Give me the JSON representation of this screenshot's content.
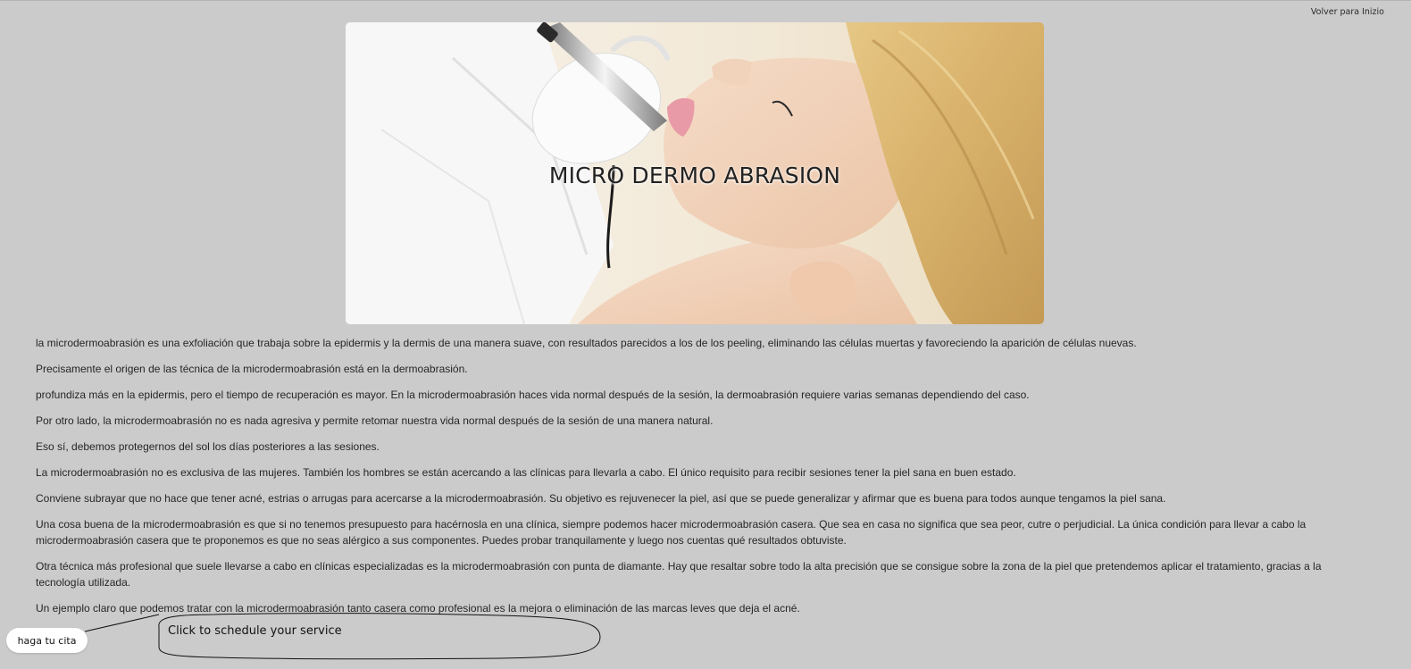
{
  "nav": {
    "back_label": "Volver para Inizio"
  },
  "hero": {
    "title": "MICRO DERMO ABRASION",
    "image": "woman-receiving-microdermabrasion-photo"
  },
  "article": {
    "paragraphs": [
      "la microdermoabrasión es una exfoliación que trabaja sobre la epidermis y la dermis de una manera suave, con resultados parecidos a los de los peeling, eliminando las células muertas y favoreciendo la aparición de células nuevas.",
      "Precisamente el origen de las técnica de la microdermoabrasión está en la dermoabrasión.",
      "profundiza más en la epidermis, pero el tiempo de recuperación es mayor. En la microdermoabrasión haces vida normal después de la sesión, la dermoabrasión requiere varias semanas dependiendo del caso.",
      "Por otro lado, la microdermoabrasión no es nada agresiva y permite retomar nuestra vida normal después de la sesión de una manera natural.",
      "Eso sí, debemos protegernos del sol los días posteriores a las sesiones.",
      "La microdermoabrasión no es exclusiva de las mujeres. También los hombres se están acercando a las clínicas para llevarla a cabo. El único requisito para recibir sesiones tener la piel sana en buen estado.",
      "Conviene subrayar que no hace que tener acné, estrias o arrugas para acercarse a la microdermoabrasión. Su objetivo es rejuvenecer la piel, así que se puede generalizar y afirmar que es buena para todos aunque tengamos la piel sana.",
      "Una cosa buena de la microdermoabrasión es que si no tenemos presupuesto para hacérnosla en una clínica, siempre podemos hacer microdermoabrasión casera. Que sea en casa no significa que sea peor, cutre o perjudicial. La única condición para llevar a cabo la microdermoabrasión casera que te proponemos es que no seas alérgico a sus componentes. Puedes probar tranquilamente y luego nos cuentas qué resultados obtuviste.",
      "Otra técnica más profesional que suele llevarse a cabo en clínicas especializadas es la microdermoabrasión con punta de diamante. Hay que resaltar sobre todo la alta precisión que se consigue sobre la zona de la piel que pretendemos aplicar el tratamiento, gracias a la tecnología utilizada.",
      "Un ejemplo claro que podemos tratar con la microdermoabrasión tanto casera como profesional es la mejora o eliminación de las marcas leves que deja el acné."
    ]
  },
  "cta": {
    "button_label": "haga tu cita",
    "callout_text": "Click to schedule your service"
  }
}
